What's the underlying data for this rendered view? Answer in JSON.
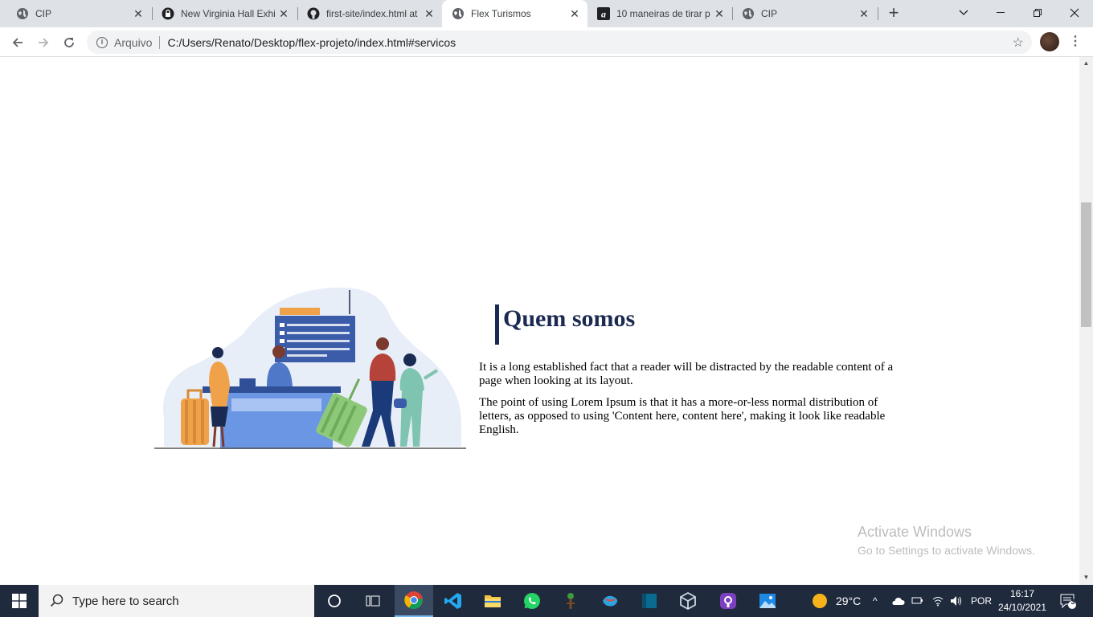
{
  "browser": {
    "tabs": [
      {
        "title": "CIP",
        "icon": "globe-icon"
      },
      {
        "title": "New Virginia Hall Exhi",
        "icon": "lock-icon"
      },
      {
        "title": "first-site/index.html at",
        "icon": "github-icon"
      },
      {
        "title": "Flex Turismos",
        "icon": "globe-icon",
        "active": true
      },
      {
        "title": "10 maneiras de tirar p",
        "icon": "a-logo-icon"
      },
      {
        "title": "CIP",
        "icon": "globe-icon"
      }
    ],
    "address": {
      "scheme_label": "Arquivo",
      "url": "C:/Users/Renato/Desktop/flex-projeto/index.html#servicos"
    }
  },
  "page": {
    "about": {
      "heading": "Quem somos",
      "paragraphs": [
        "It is a long established fact that a reader will be distracted by the readable content of a page when looking at its layout.",
        "The point of using Lorem Ipsum is that it has a more-or-less normal distribution of letters, as opposed to using 'Content here, content here', making it look like readable English."
      ]
    }
  },
  "watermark": {
    "title": "Activate Windows",
    "subtitle": "Go to Settings to activate Windows."
  },
  "taskbar": {
    "search_placeholder": "Type here to search",
    "weather": "29°C",
    "language": "POR",
    "time": "16:17",
    "date": "24/10/2021",
    "notifications": "3"
  },
  "colors": {
    "heading": "#1b2a52",
    "tabstrip": "#dee1e6",
    "taskbar": "#1f2a3d"
  }
}
